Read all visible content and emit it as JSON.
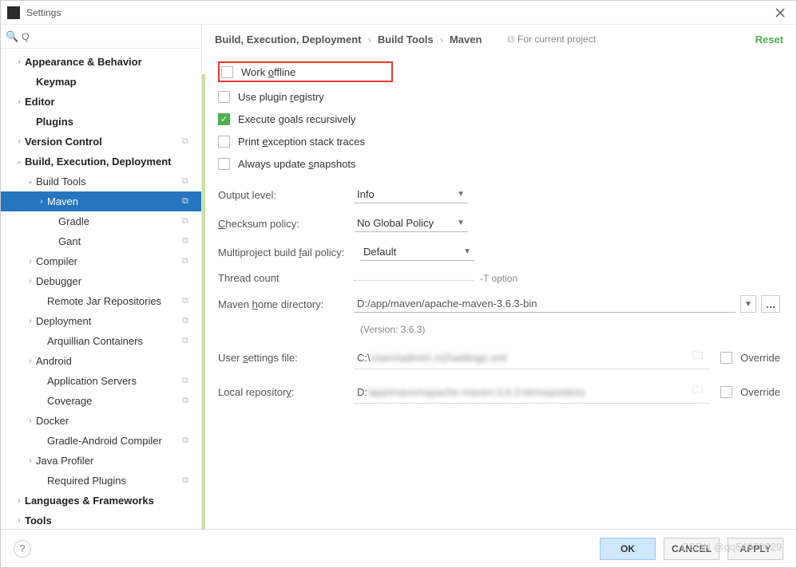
{
  "title": "Settings",
  "search_placeholder": "Q",
  "sidebar": {
    "items": [
      {
        "label": "Appearance & Behavior",
        "bold": true,
        "arrow": ">",
        "indent": 16,
        "copy": false
      },
      {
        "label": "Keymap",
        "bold": true,
        "arrow": "",
        "indent": 30,
        "copy": false
      },
      {
        "label": "Editor",
        "bold": true,
        "arrow": ">",
        "indent": 16,
        "copy": false
      },
      {
        "label": "Plugins",
        "bold": true,
        "arrow": "",
        "indent": 30,
        "copy": false
      },
      {
        "label": "Version Control",
        "bold": true,
        "arrow": ">",
        "indent": 16,
        "copy": true
      },
      {
        "label": "Build, Execution, Deployment",
        "bold": true,
        "arrow": "v",
        "indent": 16,
        "copy": false
      },
      {
        "label": "Build Tools",
        "bold": false,
        "arrow": "v",
        "indent": 30,
        "copy": true
      },
      {
        "label": "Maven",
        "bold": false,
        "arrow": ">",
        "indent": 44,
        "copy": true,
        "selected": true
      },
      {
        "label": "Gradle",
        "bold": false,
        "arrow": "",
        "indent": 58,
        "copy": true
      },
      {
        "label": "Gant",
        "bold": false,
        "arrow": "",
        "indent": 58,
        "copy": true
      },
      {
        "label": "Compiler",
        "bold": false,
        "arrow": ">",
        "indent": 30,
        "copy": true
      },
      {
        "label": "Debugger",
        "bold": false,
        "arrow": ">",
        "indent": 30,
        "copy": false
      },
      {
        "label": "Remote Jar Repositories",
        "bold": false,
        "arrow": "",
        "indent": 44,
        "copy": true
      },
      {
        "label": "Deployment",
        "bold": false,
        "arrow": ">",
        "indent": 30,
        "copy": true
      },
      {
        "label": "Arquillian Containers",
        "bold": false,
        "arrow": "",
        "indent": 44,
        "copy": true
      },
      {
        "label": "Android",
        "bold": false,
        "arrow": ">",
        "indent": 30,
        "copy": false
      },
      {
        "label": "Application Servers",
        "bold": false,
        "arrow": "",
        "indent": 44,
        "copy": true
      },
      {
        "label": "Coverage",
        "bold": false,
        "arrow": "",
        "indent": 44,
        "copy": true
      },
      {
        "label": "Docker",
        "bold": false,
        "arrow": ">",
        "indent": 30,
        "copy": false
      },
      {
        "label": "Gradle-Android Compiler",
        "bold": false,
        "arrow": "",
        "indent": 44,
        "copy": true
      },
      {
        "label": "Java Profiler",
        "bold": false,
        "arrow": ">",
        "indent": 30,
        "copy": false
      },
      {
        "label": "Required Plugins",
        "bold": false,
        "arrow": "",
        "indent": 44,
        "copy": true
      },
      {
        "label": "Languages & Frameworks",
        "bold": true,
        "arrow": ">",
        "indent": 16,
        "copy": false
      },
      {
        "label": "Tools",
        "bold": true,
        "arrow": ">",
        "indent": 16,
        "copy": false
      }
    ]
  },
  "breadcrumb": [
    "Build, Execution, Deployment",
    "Build Tools",
    "Maven"
  ],
  "project_badge": "For current project",
  "reset": "Reset",
  "checks": {
    "work_offline": "Work offline",
    "plugin_registry": "Use plugin registry",
    "execute_recursive": "Execute goals recursively",
    "print_exception": "Print exception stack traces",
    "always_update": "Always update snapshots"
  },
  "fields": {
    "output_level_label": "Output level:",
    "output_level_value": "Info",
    "checksum_label": "Checksum policy:",
    "checksum_value": "No Global Policy",
    "multiproject_label": "Multiproject build fail policy:",
    "multiproject_value": "Default",
    "thread_label": "Thread count",
    "thread_suffix": "-T option",
    "home_label": "Maven home directory:",
    "home_value": "D:/app/maven/apache-maven-3.6.3-bin",
    "version": "(Version: 3.6.3)",
    "settings_label": "User settings file:",
    "settings_value": "C:\\",
    "repo_label": "Local repository:",
    "repo_value": "D:",
    "override": "Override"
  },
  "buttons": {
    "ok": "OK",
    "cancel": "CANCEL",
    "apply": "APPLY"
  },
  "watermark": "CSDN @qq54979629"
}
